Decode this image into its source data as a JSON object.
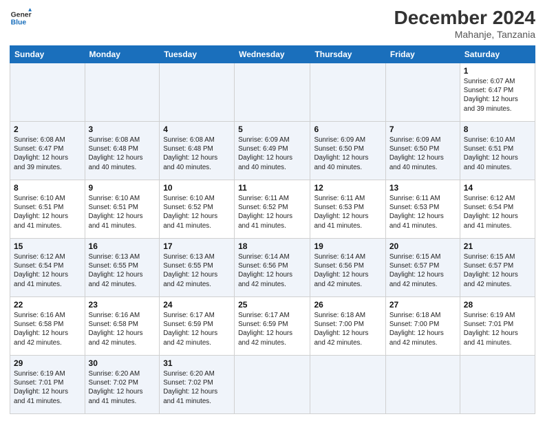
{
  "header": {
    "logo_line1": "General",
    "logo_line2": "Blue",
    "month_year": "December 2024",
    "location": "Mahanje, Tanzania"
  },
  "calendar": {
    "days_of_week": [
      "Sunday",
      "Monday",
      "Tuesday",
      "Wednesday",
      "Thursday",
      "Friday",
      "Saturday"
    ],
    "weeks": [
      [
        {
          "day": "",
          "info": ""
        },
        {
          "day": "",
          "info": ""
        },
        {
          "day": "",
          "info": ""
        },
        {
          "day": "",
          "info": ""
        },
        {
          "day": "",
          "info": ""
        },
        {
          "day": "",
          "info": ""
        },
        {
          "day": "1",
          "info": "Sunrise: 6:07 AM\nSunset: 6:47 PM\nDaylight: 12 hours\nand 39 minutes."
        }
      ],
      [
        {
          "day": "2",
          "info": "Sunrise: 6:08 AM\nSunset: 6:47 PM\nDaylight: 12 hours\nand 39 minutes."
        },
        {
          "day": "3",
          "info": "Sunrise: 6:08 AM\nSunset: 6:48 PM\nDaylight: 12 hours\nand 40 minutes."
        },
        {
          "day": "4",
          "info": "Sunrise: 6:08 AM\nSunset: 6:48 PM\nDaylight: 12 hours\nand 40 minutes."
        },
        {
          "day": "5",
          "info": "Sunrise: 6:09 AM\nSunset: 6:49 PM\nDaylight: 12 hours\nand 40 minutes."
        },
        {
          "day": "6",
          "info": "Sunrise: 6:09 AM\nSunset: 6:50 PM\nDaylight: 12 hours\nand 40 minutes."
        },
        {
          "day": "7",
          "info": "Sunrise: 6:09 AM\nSunset: 6:50 PM\nDaylight: 12 hours\nand 40 minutes."
        },
        {
          "day": "8",
          "info": ""
        }
      ],
      [
        {
          "day": "8",
          "info": "Sunrise: 6:10 AM\nSunset: 6:51 PM\nDaylight: 12 hours\nand 41 minutes."
        },
        {
          "day": "9",
          "info": "Sunrise: 6:10 AM\nSunset: 6:51 PM\nDaylight: 12 hours\nand 41 minutes."
        },
        {
          "day": "10",
          "info": "Sunrise: 6:10 AM\nSunset: 6:52 PM\nDaylight: 12 hours\nand 41 minutes."
        },
        {
          "day": "11",
          "info": "Sunrise: 6:11 AM\nSunset: 6:52 PM\nDaylight: 12 hours\nand 41 minutes."
        },
        {
          "day": "12",
          "info": "Sunrise: 6:11 AM\nSunset: 6:53 PM\nDaylight: 12 hours\nand 41 minutes."
        },
        {
          "day": "13",
          "info": "Sunrise: 6:11 AM\nSunset: 6:53 PM\nDaylight: 12 hours\nand 41 minutes."
        },
        {
          "day": "14",
          "info": "Sunrise: 6:12 AM\nSunset: 6:54 PM\nDaylight: 12 hours\nand 41 minutes."
        }
      ],
      [
        {
          "day": "15",
          "info": "Sunrise: 6:12 AM\nSunset: 6:54 PM\nDaylight: 12 hours\nand 41 minutes."
        },
        {
          "day": "16",
          "info": "Sunrise: 6:13 AM\nSunset: 6:55 PM\nDaylight: 12 hours\nand 42 minutes."
        },
        {
          "day": "17",
          "info": "Sunrise: 6:13 AM\nSunset: 6:55 PM\nDaylight: 12 hours\nand 42 minutes."
        },
        {
          "day": "18",
          "info": "Sunrise: 6:14 AM\nSunset: 6:56 PM\nDaylight: 12 hours\nand 42 minutes."
        },
        {
          "day": "19",
          "info": "Sunrise: 6:14 AM\nSunset: 6:56 PM\nDaylight: 12 hours\nand 42 minutes."
        },
        {
          "day": "20",
          "info": "Sunrise: 6:15 AM\nSunset: 6:57 PM\nDaylight: 12 hours\nand 42 minutes."
        },
        {
          "day": "21",
          "info": "Sunrise: 6:15 AM\nSunset: 6:57 PM\nDaylight: 12 hours\nand 42 minutes."
        }
      ],
      [
        {
          "day": "22",
          "info": "Sunrise: 6:16 AM\nSunset: 6:58 PM\nDaylight: 12 hours\nand 42 minutes."
        },
        {
          "day": "23",
          "info": "Sunrise: 6:16 AM\nSunset: 6:58 PM\nDaylight: 12 hours\nand 42 minutes."
        },
        {
          "day": "24",
          "info": "Sunrise: 6:17 AM\nSunset: 6:59 PM\nDaylight: 12 hours\nand 42 minutes."
        },
        {
          "day": "25",
          "info": "Sunrise: 6:17 AM\nSunset: 6:59 PM\nDaylight: 12 hours\nand 42 minutes."
        },
        {
          "day": "26",
          "info": "Sunrise: 6:18 AM\nSunset: 7:00 PM\nDaylight: 12 hours\nand 42 minutes."
        },
        {
          "day": "27",
          "info": "Sunrise: 6:18 AM\nSunset: 7:00 PM\nDaylight: 12 hours\nand 42 minutes."
        },
        {
          "day": "28",
          "info": "Sunrise: 6:19 AM\nSunset: 7:01 PM\nDaylight: 12 hours\nand 41 minutes."
        }
      ],
      [
        {
          "day": "29",
          "info": "Sunrise: 6:19 AM\nSunset: 7:01 PM\nDaylight: 12 hours\nand 41 minutes."
        },
        {
          "day": "30",
          "info": "Sunrise: 6:20 AM\nSunset: 7:02 PM\nDaylight: 12 hours\nand 41 minutes."
        },
        {
          "day": "31",
          "info": "Sunrise: 6:20 AM\nSunset: 7:02 PM\nDaylight: 12 hours\nand 41 minutes."
        },
        {
          "day": "",
          "info": ""
        },
        {
          "day": "",
          "info": ""
        },
        {
          "day": "",
          "info": ""
        },
        {
          "day": "",
          "info": ""
        }
      ]
    ]
  }
}
